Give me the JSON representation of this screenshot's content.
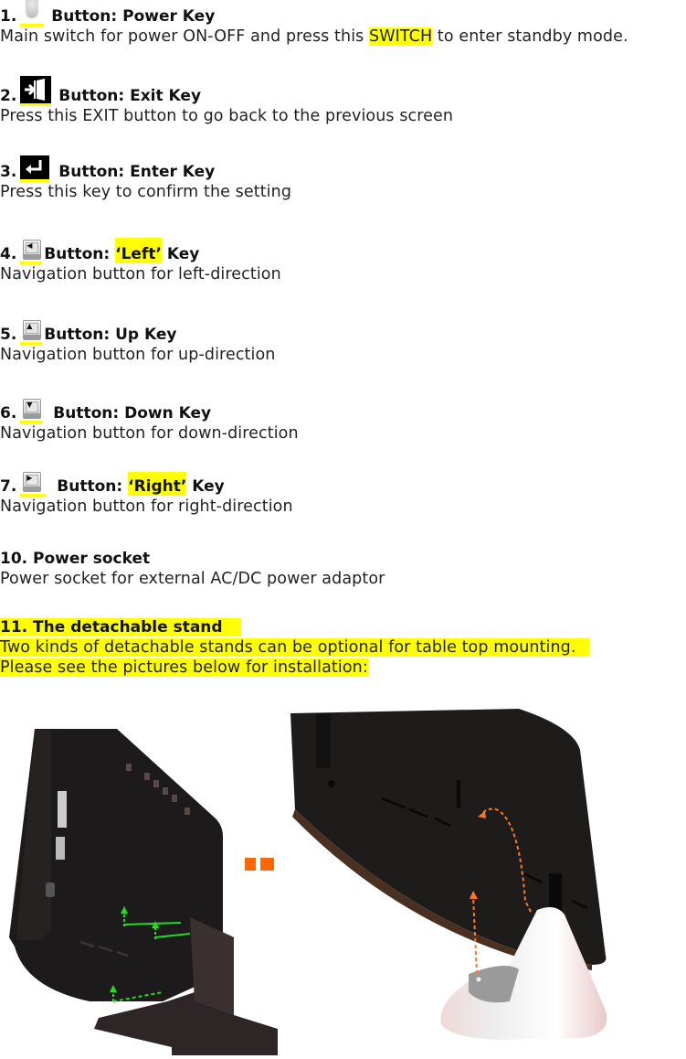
{
  "items": [
    {
      "number": "1.",
      "icon": "power-key-icon",
      "title": "Button: Power Key",
      "desc_before": "Main switch for power ON-OFF and press this ",
      "desc_highlight": "SWITCH",
      "desc_after": " to enter standby mode."
    },
    {
      "number": "2.",
      "icon": "exit-key-icon",
      "title": "Button: Exit Key",
      "desc": "Press this EXIT button to go back to the previous screen"
    },
    {
      "number": "3.",
      "icon": "enter-key-icon",
      "title": "Button: Enter Key",
      "desc": "Press this key to confirm the setting"
    },
    {
      "number": "4.",
      "icon": "left-key-icon",
      "title_before": "Button: ",
      "title_highlight": "‘Left’",
      "title_after": " Key",
      "desc": "Navigation button for left-direction"
    },
    {
      "number": "5.",
      "icon": "up-key-icon",
      "title": "Button: Up Key",
      "desc": "Navigation button for up-direction"
    },
    {
      "number": "6.",
      "icon": "down-key-icon",
      "title": "Button: Down Key",
      "desc": "Navigation button for down-direction"
    },
    {
      "number": "7.",
      "icon": "right-key-icon",
      "title_before": "Button: ",
      "title_highlight": "‘Right’",
      "title_after": " Key",
      "desc": "Navigation button for right-direction"
    },
    {
      "number": "10.",
      "title": "Power socket",
      "desc": "Power socket for external AC/DC power adaptor"
    },
    {
      "number": "11.",
      "title": "The detachable stand",
      "desc_lines": [
        "Two kinds of detachable stands can be optional for table top mounting.",
        "Please see the pictures below for installation:"
      ]
    }
  ],
  "nav_glyphs": {
    "left": "◀",
    "up": "▲",
    "down": "▼",
    "right": "▶"
  },
  "figures": [
    {
      "name": "stand-installation-left",
      "description": "Monitor back with bracket stand, green dashed insertion arrows"
    },
    {
      "name": "stand-installation-right",
      "description": "Monitor back with cone stand, orange dashed insertion arrows"
    }
  ],
  "colors": {
    "highlight": "#ffff00",
    "accent_orange": "#ff6600",
    "arrow_green": "#22dd22"
  }
}
